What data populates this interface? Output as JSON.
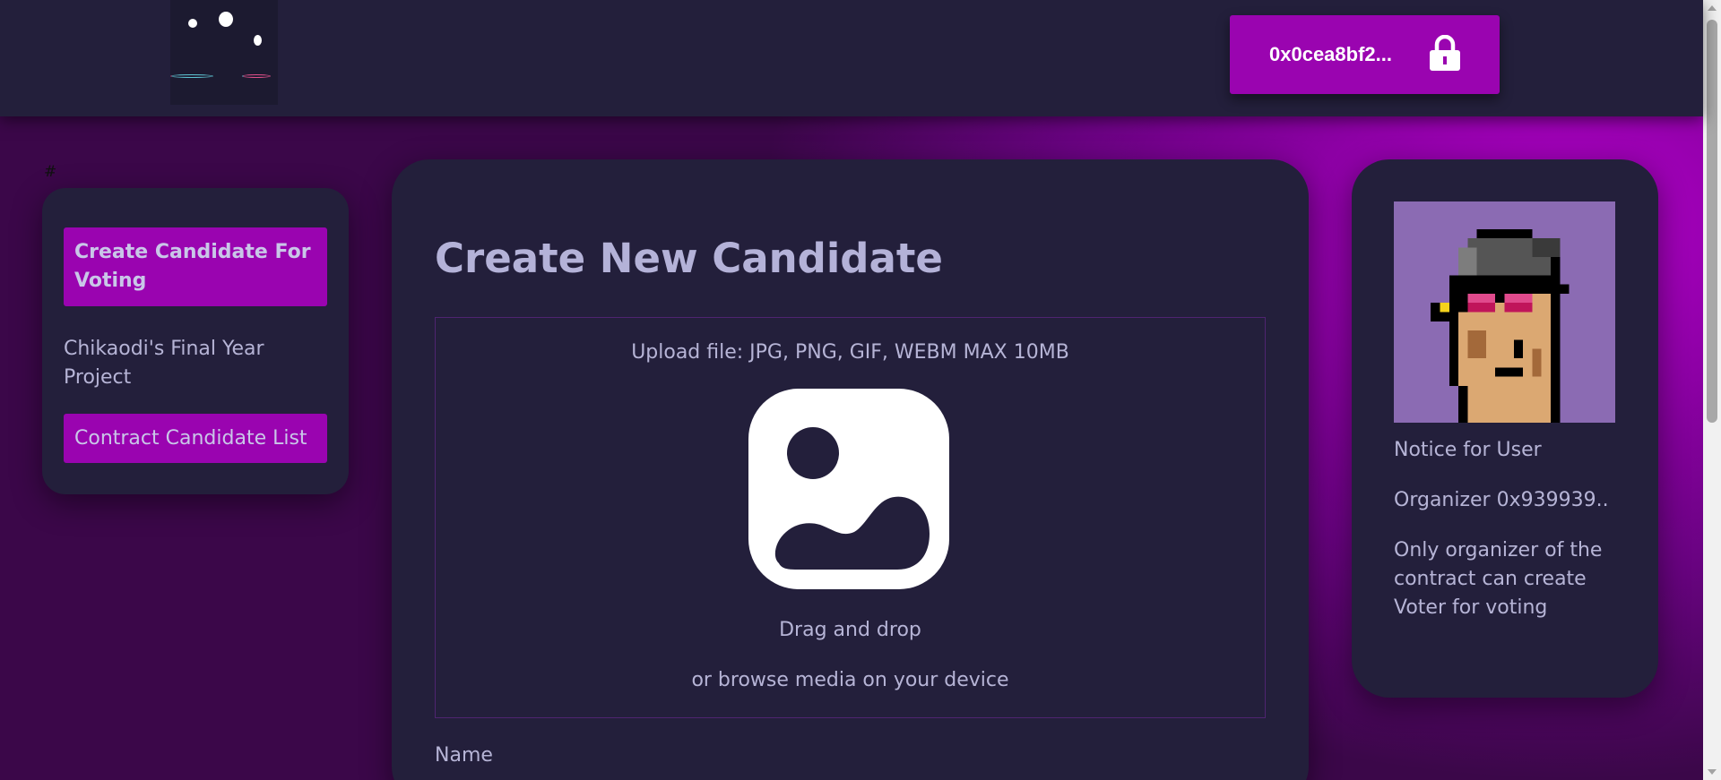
{
  "navbar": {
    "logo_icon": "bubbles-logo",
    "wallet_address": "0x0cea8bf2...",
    "wallet_icon": "lock-icon"
  },
  "hash_text": "#",
  "sidebar": {
    "create_candidate_label": "Create Candidate For Voting",
    "project_name": "Chikaodi's Final Year Project",
    "candidate_list_label": "Contract Candidate List"
  },
  "main": {
    "title": "Create New Candidate",
    "upload_hint": "Upload file: JPG, PNG, GIF, WEBM MAX 10MB",
    "upload_icon": "image-icon",
    "drag_text": "Drag and drop",
    "browse_text": "or browse media on your device",
    "name_label": "Name"
  },
  "notice": {
    "avatar_icon": "pixel-punk-avatar",
    "heading": "Notice for User",
    "organizer": "Organizer 0x939939..",
    "message": "Only organizer of the contract can create Voter for voting"
  },
  "colors": {
    "accent": "#9a04b0",
    "card_bg": "#231f3b",
    "text": "#b6b4d6",
    "title": "#b4b2d8"
  }
}
